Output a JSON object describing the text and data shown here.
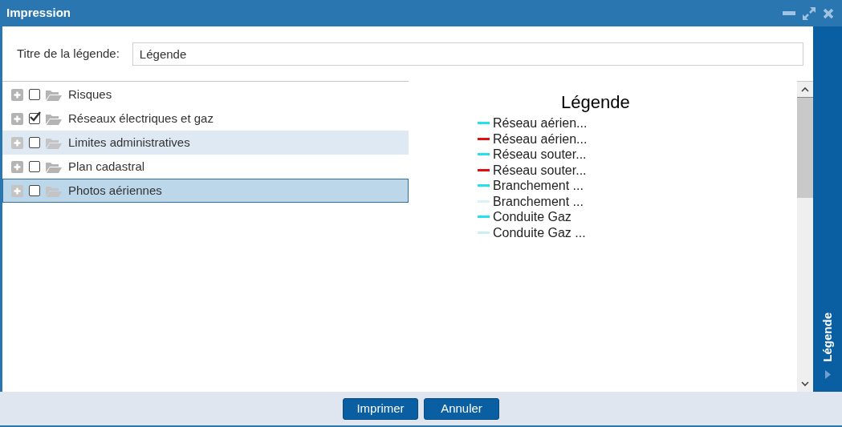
{
  "window": {
    "title": "Impression"
  },
  "legend_title": {
    "label": "Titre de la légende:",
    "value": "Légende"
  },
  "tree": [
    {
      "label": "Risques",
      "checked": false,
      "hovered": false,
      "selected": false
    },
    {
      "label": "Réseaux électriques et gaz",
      "checked": true,
      "hovered": false,
      "selected": false
    },
    {
      "label": "Limites administratives",
      "checked": false,
      "hovered": true,
      "selected": false
    },
    {
      "label": "Plan cadastral",
      "checked": false,
      "hovered": false,
      "selected": false
    },
    {
      "label": "Photos aériennes",
      "checked": false,
      "hovered": false,
      "selected": true
    }
  ],
  "preview": {
    "title": "Légende",
    "items": [
      {
        "label": "Réseau aérien...",
        "color": "#22e0f0"
      },
      {
        "label": "Réseau aérien...",
        "color": "#e01010"
      },
      {
        "label": "Réseau souter...",
        "color": "#22e0f0"
      },
      {
        "label": "Réseau souter...",
        "color": "#e01010"
      },
      {
        "label": "Branchement ...",
        "color": "#22e0f0"
      },
      {
        "label": "Branchement ...",
        "color": "#d8f4f8"
      },
      {
        "label": "Conduite Gaz",
        "color": "#22e0f0"
      },
      {
        "label": "Conduite Gaz ...",
        "color": "#c8f0f4"
      }
    ]
  },
  "side_panel": {
    "label": "Légende"
  },
  "buttons": [
    "Imprimer",
    "Annuler"
  ]
}
